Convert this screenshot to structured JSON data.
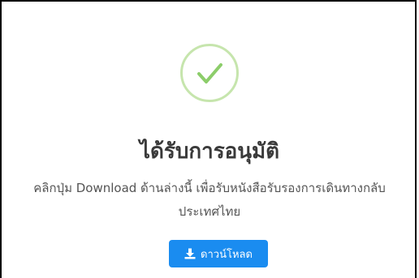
{
  "dialog": {
    "title": "ได้รับการอนุมัติ",
    "message": "คลิกปุ่ม Download ด้านล่างนี้ เพื่อรับหนังสือรับรองการเดินทางกลับประเทศไทย",
    "status_icon": "check-icon",
    "download_button": {
      "label": "ดาวน์โหลด",
      "icon": "download-icon"
    }
  },
  "colors": {
    "success_ring": "#c6e5ad",
    "success_check": "#8ccd6a",
    "button_bg": "#1a8cf0",
    "button_text": "#ffffff",
    "title_text": "#3a3a3a",
    "body_text": "#545454"
  }
}
